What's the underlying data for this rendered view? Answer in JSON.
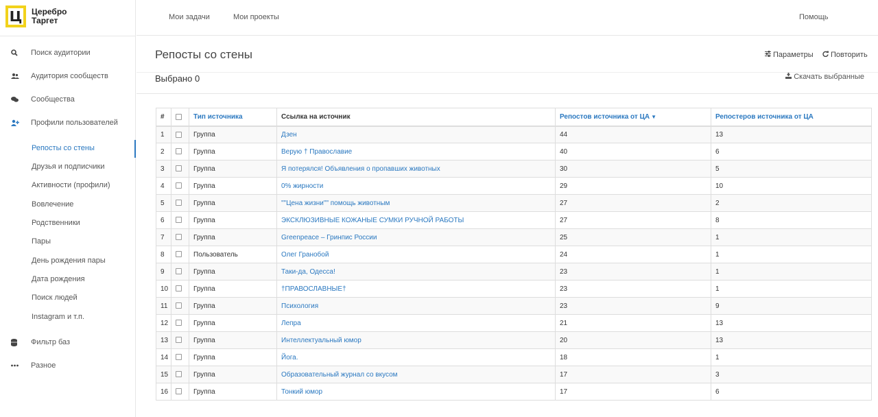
{
  "logo": {
    "mark": "Ц",
    "line1": "Церебро",
    "line2": "Таргет"
  },
  "sidebar": {
    "items": [
      {
        "icon": "search-icon",
        "glyph": "⚲",
        "label": "Поиск аудитории"
      },
      {
        "icon": "users-icon",
        "glyph": "👥",
        "label": "Аудитория сообществ"
      },
      {
        "icon": "comments-icon",
        "glyph": "💬",
        "label": "Сообщества"
      },
      {
        "icon": "user-plus-icon",
        "glyph": "👤",
        "label": "Профили пользователей"
      }
    ],
    "subitems": [
      "Репосты со стены",
      "Друзья и подписчики",
      "Активности (профили)",
      "Вовлечение",
      "Родственники",
      "Пары",
      "День рождения пары",
      "Дата рождения",
      "Поиск людей",
      "Instagram и т.п."
    ],
    "bottom_items": [
      {
        "icon": "database-icon",
        "glyph": "☰",
        "label": "Фильтр баз"
      },
      {
        "icon": "ellipsis-icon",
        "glyph": "•••",
        "label": "Разное"
      }
    ]
  },
  "topnav": {
    "tasks": "Мои задачи",
    "projects": "Мои проекты",
    "help": "Помощь"
  },
  "header": {
    "title": "Репосты со стены",
    "params": "Параметры",
    "params_icon": "sliders-icon",
    "repeat": "Повторить",
    "repeat_icon": "refresh-icon"
  },
  "selection": {
    "text": "Выбрано 0",
    "download": "Скачать выбранные",
    "download_icon": "download-icon"
  },
  "table": {
    "headers": [
      "#",
      "",
      "Тип источника",
      "Ссылка на источник",
      "Репостов источника от ЦА",
      "Репостеров источника от ЦА"
    ],
    "rows": [
      [
        "1",
        "Группа",
        "Дзен",
        "44",
        "13"
      ],
      [
        "2",
        "Группа",
        "Верую † Православие",
        "40",
        "6"
      ],
      [
        "3",
        "Группа",
        "Я потерялся! Объявления о пропавших животных",
        "30",
        "5"
      ],
      [
        "4",
        "Группа",
        "0% жирности",
        "29",
        "10"
      ],
      [
        "5",
        "Группа",
        "\"\"Цена жизни\"\" помощь животным",
        "27",
        "2"
      ],
      [
        "6",
        "Группа",
        "ЭКСКЛЮЗИВНЫЕ КОЖАНЫЕ СУМКИ РУЧНОЙ РАБОТЫ",
        "27",
        "8"
      ],
      [
        "7",
        "Группа",
        "Greenpeace – Гринпис России",
        "25",
        "1"
      ],
      [
        "8",
        "Пользователь",
        "Олег Гранобой",
        "24",
        "1"
      ],
      [
        "9",
        "Группа",
        "Таки-да, Одесса!",
        "23",
        "1"
      ],
      [
        "10",
        "Группа",
        "†ПРАВОСЛАВНЫЕ†",
        "23",
        "1"
      ],
      [
        "11",
        "Группа",
        "Психология",
        "23",
        "9"
      ],
      [
        "12",
        "Группа",
        "Лепра",
        "21",
        "13"
      ],
      [
        "13",
        "Группа",
        "Интеллектуальный юмор",
        "20",
        "13"
      ],
      [
        "14",
        "Группа",
        "Йога.",
        "18",
        "1"
      ],
      [
        "15",
        "Группа",
        "Образовательный журнал со вкусом",
        "17",
        "3"
      ],
      [
        "16",
        "Группа",
        "Тонкий юмор",
        "17",
        "6"
      ]
    ]
  },
  "colors": {
    "accent": "#2a78c0",
    "logo_yellow": "#f2d21b"
  }
}
